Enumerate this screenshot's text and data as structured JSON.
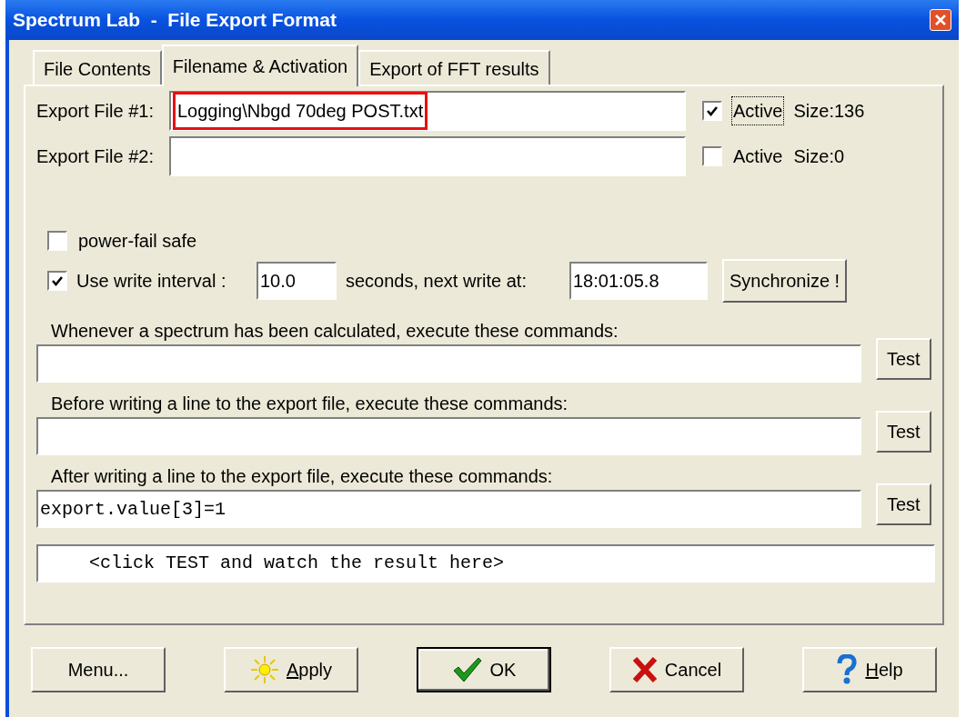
{
  "window": {
    "title": "Spectrum Lab  -  File Export Format"
  },
  "tabs": [
    {
      "label": "File Contents",
      "selected": false
    },
    {
      "label": "Filename & Activation",
      "selected": true
    },
    {
      "label": "Export of FFT results",
      "selected": false
    }
  ],
  "export_files": [
    {
      "label": "Export File #1:",
      "value": "Logging\\Nbgd 70deg POST.txt",
      "highlighted": true,
      "active_label": "Active",
      "active": true,
      "focused": true,
      "size": "Size:136"
    },
    {
      "label": "Export File #2:",
      "highlighted": false,
      "active_label": "Active",
      "active": false,
      "focused": false,
      "size": "Size:0"
    }
  ],
  "power_fail_safe": {
    "label": "power-fail safe",
    "checked": false
  },
  "write_interval": {
    "label": "Use write interval :",
    "checked": true,
    "value": "10.0",
    "seconds_label": "seconds, next write at:",
    "next_write": "18:01:05.8",
    "sync_button": "Synchronize !"
  },
  "commands": [
    {
      "label": "Whenever a spectrum has been calculated, execute these commands:",
      "button": "Test"
    },
    {
      "label": "Before writing a line to the export file, execute these commands:",
      "button": "Test"
    },
    {
      "label": "After writing a line to the export file, execute these commands:",
      "value": "export.value[3]=1",
      "button": "Test"
    }
  ],
  "result": "<click TEST and watch the result here>",
  "buttons": [
    {
      "kind": "menu",
      "label": "Menu...",
      "default": false
    },
    {
      "kind": "apply",
      "accel": "A",
      "label": "pply",
      "default": false
    },
    {
      "kind": "ok",
      "label": "OK",
      "default": true
    },
    {
      "kind": "cancel",
      "label": "Cancel",
      "default": false
    },
    {
      "kind": "help",
      "accel": "H",
      "label": "elp",
      "default": false
    }
  ]
}
